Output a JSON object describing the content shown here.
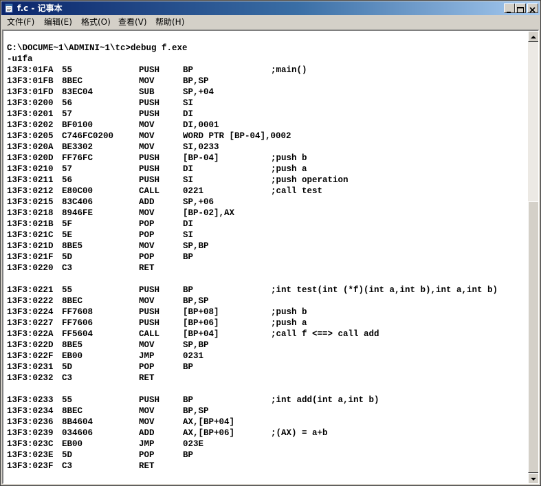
{
  "window": {
    "title": "f.c - 记事本",
    "icon": "notepad-icon",
    "controls": [
      "minimize-icon",
      "maximize-icon",
      "close-icon"
    ]
  },
  "menu": {
    "file": "文件(F)",
    "edit": "编辑(E)",
    "format": "格式(O)",
    "view": "查看(V)",
    "help": "帮助(H)"
  },
  "editor": {
    "lines": [
      {
        "addr": "C:\\DOCUME~1\\ADMINI~1\\tc>debug f.exe",
        "hex": "",
        "op": "",
        "arg": "",
        "cmt": ""
      },
      {
        "addr": "-u1fa",
        "hex": "",
        "op": "",
        "arg": "",
        "cmt": ""
      },
      {
        "addr": "13F3:01FA",
        "hex": "55",
        "op": "PUSH",
        "arg": "BP",
        "cmt": ";main()"
      },
      {
        "addr": "13F3:01FB",
        "hex": "8BEC",
        "op": "MOV",
        "arg": "BP,SP",
        "cmt": ""
      },
      {
        "addr": "13F3:01FD",
        "hex": "83EC04",
        "op": "SUB",
        "arg": "SP,+04",
        "cmt": ""
      },
      {
        "addr": "13F3:0200",
        "hex": "56",
        "op": "PUSH",
        "arg": "SI",
        "cmt": ""
      },
      {
        "addr": "13F3:0201",
        "hex": "57",
        "op": "PUSH",
        "arg": "DI",
        "cmt": ""
      },
      {
        "addr": "13F3:0202",
        "hex": "BF0100",
        "op": "MOV",
        "arg": "DI,0001",
        "cmt": ""
      },
      {
        "addr": "13F3:0205",
        "hex": "C746FC0200",
        "op": "MOV",
        "arg": "WORD PTR [BP-04],0002",
        "cmt": ""
      },
      {
        "addr": "13F3:020A",
        "hex": "BE3302",
        "op": "MOV",
        "arg": "SI,0233",
        "cmt": ""
      },
      {
        "addr": "13F3:020D",
        "hex": "FF76FC",
        "op": "PUSH",
        "arg": "[BP-04]",
        "cmt": ";push b"
      },
      {
        "addr": "13F3:0210",
        "hex": "57",
        "op": "PUSH",
        "arg": "DI",
        "cmt": ";push a"
      },
      {
        "addr": "13F3:0211",
        "hex": "56",
        "op": "PUSH",
        "arg": "SI",
        "cmt": ";push operation"
      },
      {
        "addr": "13F3:0212",
        "hex": "E80C00",
        "op": "CALL",
        "arg": "0221",
        "cmt": ";call test"
      },
      {
        "addr": "13F3:0215",
        "hex": "83C406",
        "op": "ADD",
        "arg": "SP,+06",
        "cmt": ""
      },
      {
        "addr": "13F3:0218",
        "hex": "8946FE",
        "op": "MOV",
        "arg": "[BP-02],AX",
        "cmt": ""
      },
      {
        "addr": "13F3:021B",
        "hex": "5F",
        "op": "POP",
        "arg": "DI",
        "cmt": ""
      },
      {
        "addr": "13F3:021C",
        "hex": "5E",
        "op": "POP",
        "arg": "SI",
        "cmt": ""
      },
      {
        "addr": "13F3:021D",
        "hex": "8BE5",
        "op": "MOV",
        "arg": "SP,BP",
        "cmt": ""
      },
      {
        "addr": "13F3:021F",
        "hex": "5D",
        "op": "POP",
        "arg": "BP",
        "cmt": ""
      },
      {
        "addr": "13F3:0220",
        "hex": "C3",
        "op": "RET",
        "arg": "",
        "cmt": ""
      },
      {
        "addr": "",
        "hex": "",
        "op": "",
        "arg": "",
        "cmt": ""
      },
      {
        "addr": "13F3:0221",
        "hex": "55",
        "op": "PUSH",
        "arg": "BP",
        "cmt": ";int test(int (*f)(int a,int b),int a,int b)"
      },
      {
        "addr": "13F3:0222",
        "hex": "8BEC",
        "op": "MOV",
        "arg": "BP,SP",
        "cmt": ""
      },
      {
        "addr": "13F3:0224",
        "hex": "FF7608",
        "op": "PUSH",
        "arg": "[BP+08]",
        "cmt": ";push b"
      },
      {
        "addr": "13F3:0227",
        "hex": "FF7606",
        "op": "PUSH",
        "arg": "[BP+06]",
        "cmt": ";push a"
      },
      {
        "addr": "13F3:022A",
        "hex": "FF5604",
        "op": "CALL",
        "arg": "[BP+04]",
        "cmt": ";call f <==> call add"
      },
      {
        "addr": "13F3:022D",
        "hex": "8BE5",
        "op": "MOV",
        "arg": "SP,BP",
        "cmt": ""
      },
      {
        "addr": "13F3:022F",
        "hex": "EB00",
        "op": "JMP",
        "arg": "0231",
        "cmt": ""
      },
      {
        "addr": "13F3:0231",
        "hex": "5D",
        "op": "POP",
        "arg": "BP",
        "cmt": ""
      },
      {
        "addr": "13F3:0232",
        "hex": "C3",
        "op": "RET",
        "arg": "",
        "cmt": ""
      },
      {
        "addr": "",
        "hex": "",
        "op": "",
        "arg": "",
        "cmt": ""
      },
      {
        "addr": "13F3:0233",
        "hex": "55",
        "op": "PUSH",
        "arg": "BP",
        "cmt": ";int add(int a,int b)"
      },
      {
        "addr": "13F3:0234",
        "hex": "8BEC",
        "op": "MOV",
        "arg": "BP,SP",
        "cmt": ""
      },
      {
        "addr": "13F3:0236",
        "hex": "8B4604",
        "op": "MOV",
        "arg": "AX,[BP+04]",
        "cmt": ""
      },
      {
        "addr": "13F3:0239",
        "hex": "034606",
        "op": "ADD",
        "arg": "AX,[BP+06]",
        "cmt": ";(AX) = a+b"
      },
      {
        "addr": "13F3:023C",
        "hex": "EB00",
        "op": "JMP",
        "arg": "023E",
        "cmt": ""
      },
      {
        "addr": "13F3:023E",
        "hex": "5D",
        "op": "POP",
        "arg": "BP",
        "cmt": ""
      },
      {
        "addr": "13F3:023F",
        "hex": "C3",
        "op": "RET",
        "arg": "",
        "cmt": ""
      }
    ]
  },
  "scrollbar": {
    "up_icon": "arrow-up-icon",
    "down_icon": "arrow-down-icon"
  }
}
